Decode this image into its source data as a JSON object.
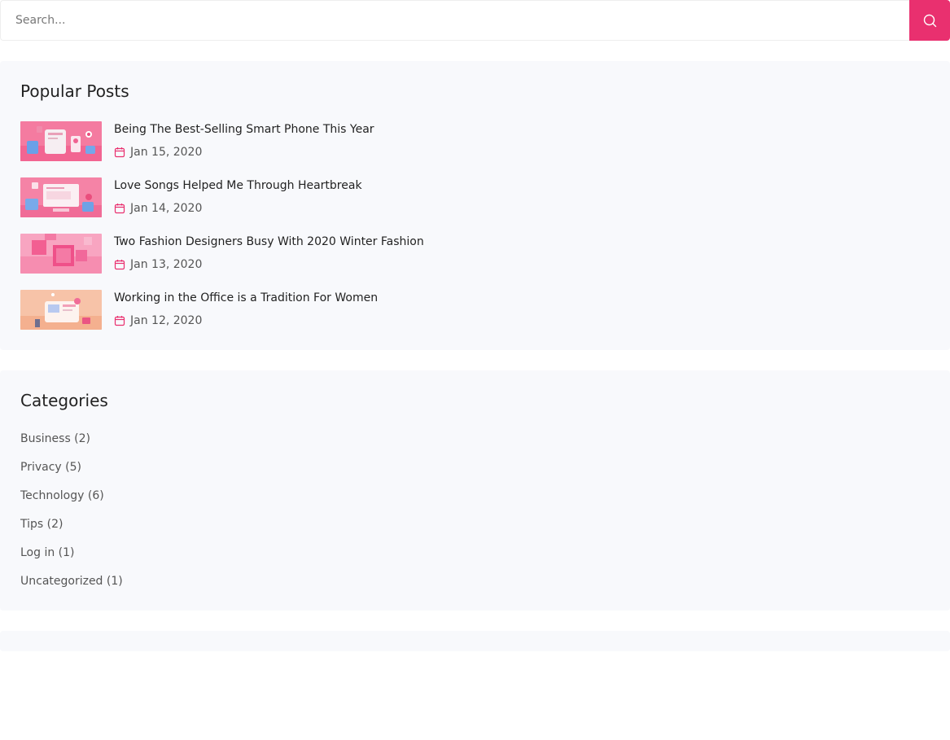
{
  "search": {
    "placeholder": "Search..."
  },
  "popular_posts": {
    "title": "Popular Posts",
    "items": [
      {
        "title": "Being The Best-Selling Smart Phone This Year",
        "date": "Jan 15, 2020"
      },
      {
        "title": "Love Songs Helped Me Through Heartbreak",
        "date": "Jan 14, 2020"
      },
      {
        "title": "Two Fashion Designers Busy With 2020 Winter Fashion",
        "date": "Jan 13, 2020"
      },
      {
        "title": "Working in the Office is a Tradition For Women",
        "date": "Jan 12, 2020"
      }
    ]
  },
  "categories": {
    "title": "Categories",
    "items": [
      {
        "label": "Business (2)"
      },
      {
        "label": "Privacy (5)"
      },
      {
        "label": "Technology (6)"
      },
      {
        "label": "Tips (2)"
      },
      {
        "label": "Log in (1)"
      },
      {
        "label": "Uncategorized (1)"
      }
    ]
  },
  "colors": {
    "accent": "#e9306f",
    "widget_bg": "#f8f9fc"
  }
}
